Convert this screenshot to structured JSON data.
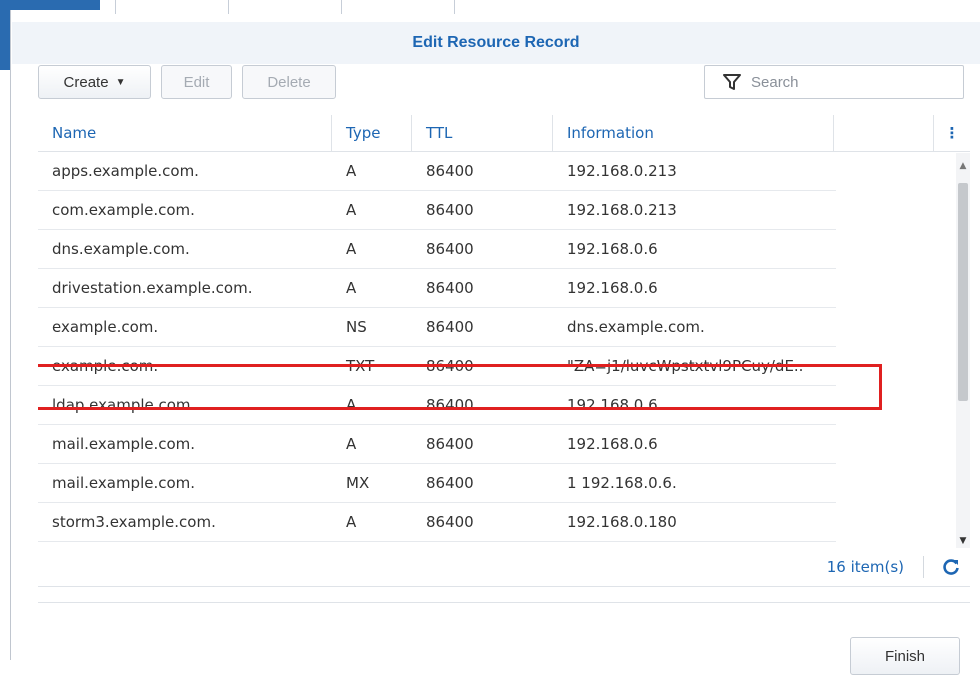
{
  "dialog": {
    "title": "Edit Resource Record"
  },
  "toolbar": {
    "create_label": "Create",
    "edit_label": "Edit",
    "delete_label": "Delete",
    "search_placeholder": "Search"
  },
  "grid": {
    "columns": [
      "Name",
      "Type",
      "TTL",
      "Information"
    ],
    "rows": [
      {
        "name": "apps.example.com.",
        "type": "A",
        "ttl": "86400",
        "info": "192.168.0.213"
      },
      {
        "name": "com.example.com.",
        "type": "A",
        "ttl": "86400",
        "info": "192.168.0.213"
      },
      {
        "name": "dns.example.com.",
        "type": "A",
        "ttl": "86400",
        "info": "192.168.0.6"
      },
      {
        "name": "drivestation.example.com.",
        "type": "A",
        "ttl": "86400",
        "info": "192.168.0.6"
      },
      {
        "name": "example.com.",
        "type": "NS",
        "ttl": "86400",
        "info": "dns.example.com."
      },
      {
        "name": "example.com.",
        "type": "TXT",
        "ttl": "86400",
        "info": "\"ZA=j1/luvcWpstxtvl9PCuy/dE.."
      },
      {
        "name": "ldap.example.com.",
        "type": "A",
        "ttl": "86400",
        "info": "192.168.0.6"
      },
      {
        "name": "mail.example.com.",
        "type": "A",
        "ttl": "86400",
        "info": "192.168.0.6"
      },
      {
        "name": "mail.example.com.",
        "type": "MX",
        "ttl": "86400",
        "info": "1 192.168.0.6."
      },
      {
        "name": "storm3.example.com.",
        "type": "A",
        "ttl": "86400",
        "info": "192.168.0.180"
      }
    ],
    "item_count": "16 item(s)"
  },
  "footer": {
    "finish_label": "Finish"
  },
  "colors": {
    "accent": "#1d66b3",
    "highlight": "#e02020"
  }
}
